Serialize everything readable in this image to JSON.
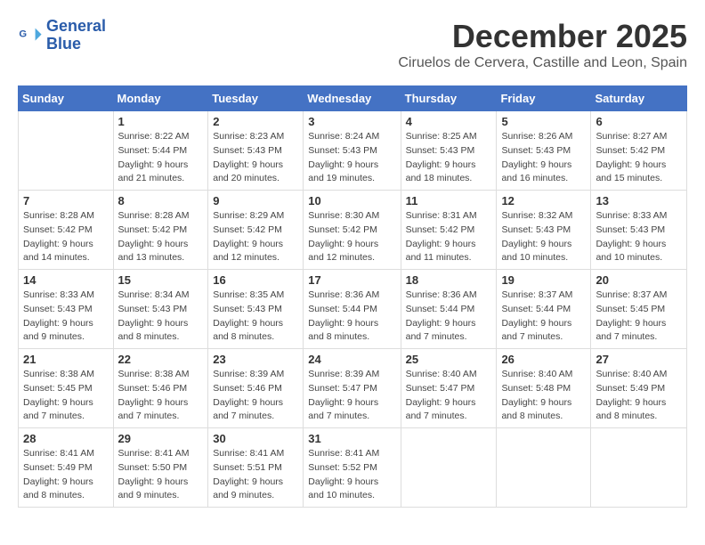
{
  "logo": {
    "line1": "General",
    "line2": "Blue"
  },
  "title": "December 2025",
  "subtitle": "Ciruelos de Cervera, Castille and Leon, Spain",
  "weekdays": [
    "Sunday",
    "Monday",
    "Tuesday",
    "Wednesday",
    "Thursday",
    "Friday",
    "Saturday"
  ],
  "weeks": [
    [
      {
        "day": "",
        "info": ""
      },
      {
        "day": "1",
        "info": "Sunrise: 8:22 AM\nSunset: 5:44 PM\nDaylight: 9 hours\nand 21 minutes."
      },
      {
        "day": "2",
        "info": "Sunrise: 8:23 AM\nSunset: 5:43 PM\nDaylight: 9 hours\nand 20 minutes."
      },
      {
        "day": "3",
        "info": "Sunrise: 8:24 AM\nSunset: 5:43 PM\nDaylight: 9 hours\nand 19 minutes."
      },
      {
        "day": "4",
        "info": "Sunrise: 8:25 AM\nSunset: 5:43 PM\nDaylight: 9 hours\nand 18 minutes."
      },
      {
        "day": "5",
        "info": "Sunrise: 8:26 AM\nSunset: 5:43 PM\nDaylight: 9 hours\nand 16 minutes."
      },
      {
        "day": "6",
        "info": "Sunrise: 8:27 AM\nSunset: 5:42 PM\nDaylight: 9 hours\nand 15 minutes."
      }
    ],
    [
      {
        "day": "7",
        "info": "Sunrise: 8:28 AM\nSunset: 5:42 PM\nDaylight: 9 hours\nand 14 minutes."
      },
      {
        "day": "8",
        "info": "Sunrise: 8:28 AM\nSunset: 5:42 PM\nDaylight: 9 hours\nand 13 minutes."
      },
      {
        "day": "9",
        "info": "Sunrise: 8:29 AM\nSunset: 5:42 PM\nDaylight: 9 hours\nand 12 minutes."
      },
      {
        "day": "10",
        "info": "Sunrise: 8:30 AM\nSunset: 5:42 PM\nDaylight: 9 hours\nand 12 minutes."
      },
      {
        "day": "11",
        "info": "Sunrise: 8:31 AM\nSunset: 5:42 PM\nDaylight: 9 hours\nand 11 minutes."
      },
      {
        "day": "12",
        "info": "Sunrise: 8:32 AM\nSunset: 5:43 PM\nDaylight: 9 hours\nand 10 minutes."
      },
      {
        "day": "13",
        "info": "Sunrise: 8:33 AM\nSunset: 5:43 PM\nDaylight: 9 hours\nand 10 minutes."
      }
    ],
    [
      {
        "day": "14",
        "info": "Sunrise: 8:33 AM\nSunset: 5:43 PM\nDaylight: 9 hours\nand 9 minutes."
      },
      {
        "day": "15",
        "info": "Sunrise: 8:34 AM\nSunset: 5:43 PM\nDaylight: 9 hours\nand 8 minutes."
      },
      {
        "day": "16",
        "info": "Sunrise: 8:35 AM\nSunset: 5:43 PM\nDaylight: 9 hours\nand 8 minutes."
      },
      {
        "day": "17",
        "info": "Sunrise: 8:36 AM\nSunset: 5:44 PM\nDaylight: 9 hours\nand 8 minutes."
      },
      {
        "day": "18",
        "info": "Sunrise: 8:36 AM\nSunset: 5:44 PM\nDaylight: 9 hours\nand 7 minutes."
      },
      {
        "day": "19",
        "info": "Sunrise: 8:37 AM\nSunset: 5:44 PM\nDaylight: 9 hours\nand 7 minutes."
      },
      {
        "day": "20",
        "info": "Sunrise: 8:37 AM\nSunset: 5:45 PM\nDaylight: 9 hours\nand 7 minutes."
      }
    ],
    [
      {
        "day": "21",
        "info": "Sunrise: 8:38 AM\nSunset: 5:45 PM\nDaylight: 9 hours\nand 7 minutes."
      },
      {
        "day": "22",
        "info": "Sunrise: 8:38 AM\nSunset: 5:46 PM\nDaylight: 9 hours\nand 7 minutes."
      },
      {
        "day": "23",
        "info": "Sunrise: 8:39 AM\nSunset: 5:46 PM\nDaylight: 9 hours\nand 7 minutes."
      },
      {
        "day": "24",
        "info": "Sunrise: 8:39 AM\nSunset: 5:47 PM\nDaylight: 9 hours\nand 7 minutes."
      },
      {
        "day": "25",
        "info": "Sunrise: 8:40 AM\nSunset: 5:47 PM\nDaylight: 9 hours\nand 7 minutes."
      },
      {
        "day": "26",
        "info": "Sunrise: 8:40 AM\nSunset: 5:48 PM\nDaylight: 9 hours\nand 8 minutes."
      },
      {
        "day": "27",
        "info": "Sunrise: 8:40 AM\nSunset: 5:49 PM\nDaylight: 9 hours\nand 8 minutes."
      }
    ],
    [
      {
        "day": "28",
        "info": "Sunrise: 8:41 AM\nSunset: 5:49 PM\nDaylight: 9 hours\nand 8 minutes."
      },
      {
        "day": "29",
        "info": "Sunrise: 8:41 AM\nSunset: 5:50 PM\nDaylight: 9 hours\nand 9 minutes."
      },
      {
        "day": "30",
        "info": "Sunrise: 8:41 AM\nSunset: 5:51 PM\nDaylight: 9 hours\nand 9 minutes."
      },
      {
        "day": "31",
        "info": "Sunrise: 8:41 AM\nSunset: 5:52 PM\nDaylight: 9 hours\nand 10 minutes."
      },
      {
        "day": "",
        "info": ""
      },
      {
        "day": "",
        "info": ""
      },
      {
        "day": "",
        "info": ""
      }
    ]
  ]
}
